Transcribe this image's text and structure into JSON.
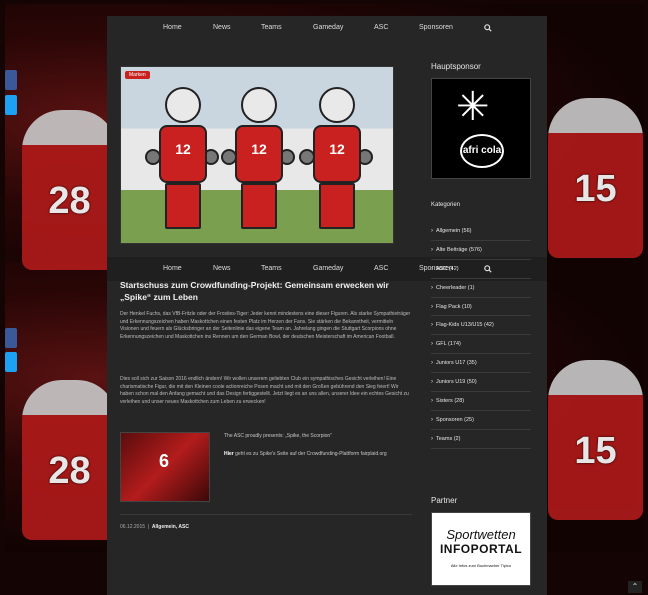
{
  "nav": {
    "items": [
      "Home",
      "News",
      "Teams",
      "Gameday",
      "ASC",
      "Sponsoren"
    ]
  },
  "hero": {
    "tag": "Marken",
    "numbers": [
      "12",
      "12",
      "12"
    ]
  },
  "article": {
    "title": "Startschuss zum Crowdfunding-Projekt: Gemeinsam erwecken wir „Spike“ zum Leben",
    "paragraph1": "Der Henkel Fuchs, das VfB-Fritzle oder der Frosties-Tiger: Jeder kennt mindestens eine dieser Figuren. Als starke Sympathieträger und Erkennungszeichen haben Maskottchen einen festen Platz im Herzen der Fans. Sie stärken die Bekanntheit, vermitteln Visionen und feuern als Glücksbringer an der Seitenlinie das eigene Team an. Jahrelang gingen die Stuttgart Scorpions ohne Erkennungszeichen und Maskottchen ins Rennen um den German Bowl, der deutschen Meisterschaft im American Football.",
    "paragraph2": "Dies soll sich zur Saison 2016 endlich ändern! Wir wollen unserem geliebten Club ein sympathisches Gesicht verleihen! Eine charismatische Figur, die mit den Kleinen coole actionreiche Posen macht und mit den Großen gebührend den Sieg feiert! Wir haben schon mal den Anfang gemacht und das Design fertiggestellt. Jetzt liegt es an uns allen, unserer Idee ein echtes Gesicht zu verleihen und unser neues Maskottchen zum Leben zu erwecken!",
    "thumb_number": "6",
    "caption": "The ASC proudly presents: „Spike, the Scorpion“",
    "link_bold": "Hier",
    "link_rest": "geht es zu Spike's Seite auf der Crowdfunding-Plattform fairplaid.org",
    "date": "06.12.2015",
    "categories": "Allgemein, ASC"
  },
  "sidebar": {
    "sponsor_heading": "Hauptsponsor",
    "sponsor_brand": "afri cola",
    "categories_heading": "Kategorien",
    "categories": [
      "Allgemein (56)",
      "Alte Beiträge (576)",
      "ASC (42)",
      "Cheerleader (1)",
      "Flag Pack (10)",
      "Flag-Kids U13/U15 (42)",
      "GFL (174)",
      "Juniors U17 (35)",
      "Juniors U19 (50)",
      "Sisters (28)",
      "Sponsoren (25)",
      "Teams (2)"
    ],
    "partner_heading": "Partner",
    "partner_line1": "Sportwetten",
    "partner_line2": "INFOPORTAL",
    "partner_line3": "Alle Infos zum Buchmacher Tipico"
  },
  "background": {
    "player_numbers": [
      "28",
      "15",
      "28",
      "15"
    ]
  },
  "colors": {
    "accent": "#c8211f",
    "column_bg": "#262626"
  }
}
